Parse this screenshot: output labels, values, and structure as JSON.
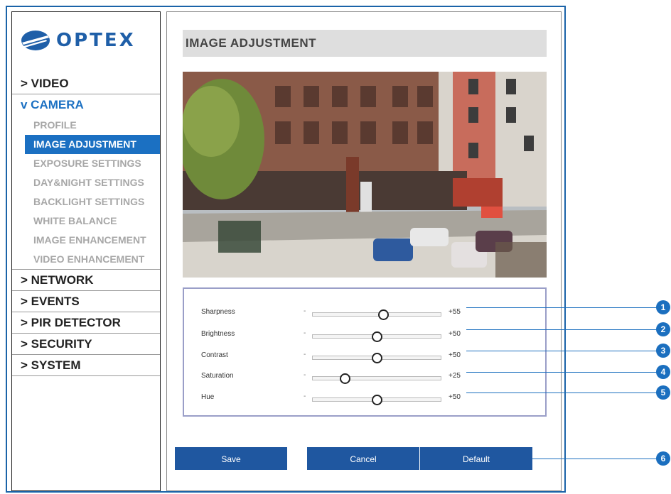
{
  "logo": {
    "text": "OPTEX"
  },
  "sidebar": {
    "menu": [
      {
        "label": "> VIDEO"
      },
      {
        "label": "v CAMERA"
      },
      {
        "label": "> NETWORK"
      },
      {
        "label": "> EVENTS"
      },
      {
        "label": "> PIR DETECTOR"
      },
      {
        "label": "> SECURITY"
      },
      {
        "label": "> SYSTEM"
      }
    ],
    "camera_sub": [
      {
        "label": "PROFILE"
      },
      {
        "label": "IMAGE ADJUSTMENT"
      },
      {
        "label": "EXPOSURE SETTINGS"
      },
      {
        "label": "DAY&NIGHT SETTINGS"
      },
      {
        "label": "BACKLIGHT SETTINGS"
      },
      {
        "label": "WHITE BALANCE"
      },
      {
        "label": "IMAGE ENHANCEMENT"
      },
      {
        "label": "VIDEO ENHANCEMENT"
      }
    ]
  },
  "page": {
    "title": "IMAGE ADJUSTMENT"
  },
  "sliders": [
    {
      "label": "Sharpness",
      "minus": "-",
      "value": "+55",
      "level": 0.55
    },
    {
      "label": "Brightness",
      "minus": "-",
      "value": "+50",
      "level": 0.5
    },
    {
      "label": "Contrast",
      "minus": "-",
      "value": "+50",
      "level": 0.5
    },
    {
      "label": "Saturation",
      "minus": "-",
      "value": "+25",
      "level": 0.25
    },
    {
      "label": "Hue",
      "minus": "-",
      "value": "+50",
      "level": 0.5
    }
  ],
  "buttons": {
    "save": "Save",
    "cancel": "Cancel",
    "default": "Default"
  },
  "callouts": [
    "1",
    "2",
    "3",
    "4",
    "5",
    "6"
  ],
  "colors": {
    "accent": "#1b70c2",
    "button": "#1f57a0",
    "callout": "#1b6fbf"
  }
}
